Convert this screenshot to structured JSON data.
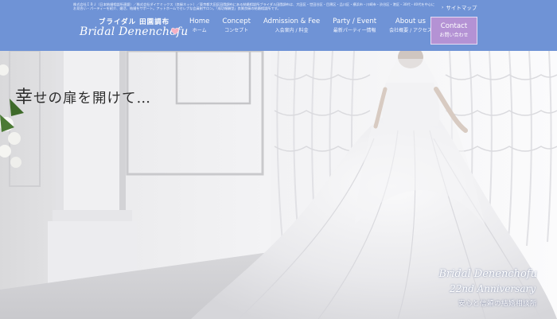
{
  "header": {
    "tagline": "株式会社ＩＢＪ（日本結婚相談所連盟）／株式会社ダイナミックス（良縁ネット）／東京都大田区田園調布にある結婚相談所ブライダル田園調布は、大田区・世田谷区・目黒区・品川区・横浜市・川崎市・渋谷区・港区・30代・40代を中心にお見合い・パーティーを紹介、婚活、結婚をサポート。アットホームでセレブな会員制サロン。「成功報酬型」良質良縁の結婚相談所です。",
    "sitemap_label": "サイトマップ",
    "logo": {
      "jp": "ブライダル 田園調布",
      "en": "Bridal Denenchofu"
    },
    "nav": [
      {
        "en": "Home",
        "jp": "ホーム"
      },
      {
        "en": "Concept",
        "jp": "コンセプト"
      },
      {
        "en": "Admission & Fee",
        "jp": "入会案内 / 料金"
      },
      {
        "en": "Party / Event",
        "jp": "最新パーティー情報"
      },
      {
        "en": "About us",
        "jp": "会社概要 / アクセス"
      }
    ],
    "contact": {
      "en": "Contact",
      "jp": "お問い合わせ"
    }
  },
  "hero": {
    "title_first": "幸",
    "title_rest": "せの扉を開けて…",
    "badge": {
      "line1": "Bridal Denenchofu",
      "line2": "22nd Anniversary",
      "line3": "安心と信頼の結婚相談所"
    }
  },
  "colors": {
    "header_bg": "#6f93d6",
    "contact_bg": "#b492d4"
  },
  "icons": [
    "chevron-right-icon",
    "heart-logo-icon"
  ]
}
